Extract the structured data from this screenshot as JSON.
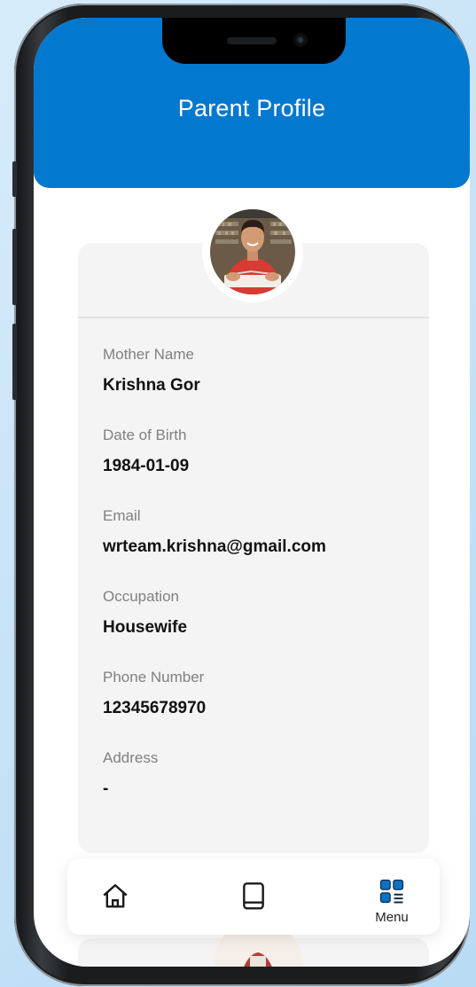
{
  "app": {
    "title": "Parent Profile"
  },
  "colors": {
    "primary": "#0378cf",
    "card_background": "#f4f4f4",
    "label_text": "#808080",
    "value_text": "#111111",
    "menu_icon": "#0a72c4"
  },
  "profile": {
    "avatar_icon": "profile-photo",
    "fields": [
      {
        "label": "Mother Name",
        "value": "Krishna Gor"
      },
      {
        "label": "Date of Birth",
        "value": "1984-01-09"
      },
      {
        "label": "Email",
        "value": "wrteam.krishna@gmail.com"
      },
      {
        "label": "Occupation",
        "value": "Housewife"
      },
      {
        "label": "Phone Number",
        "value": "12345678970"
      },
      {
        "label": "Address",
        "value": "-"
      }
    ]
  },
  "bottom_nav": {
    "items": [
      {
        "icon": "home-icon",
        "label": ""
      },
      {
        "icon": "book-icon",
        "label": ""
      },
      {
        "icon": "menu-grid-icon",
        "label": "Menu"
      }
    ]
  }
}
